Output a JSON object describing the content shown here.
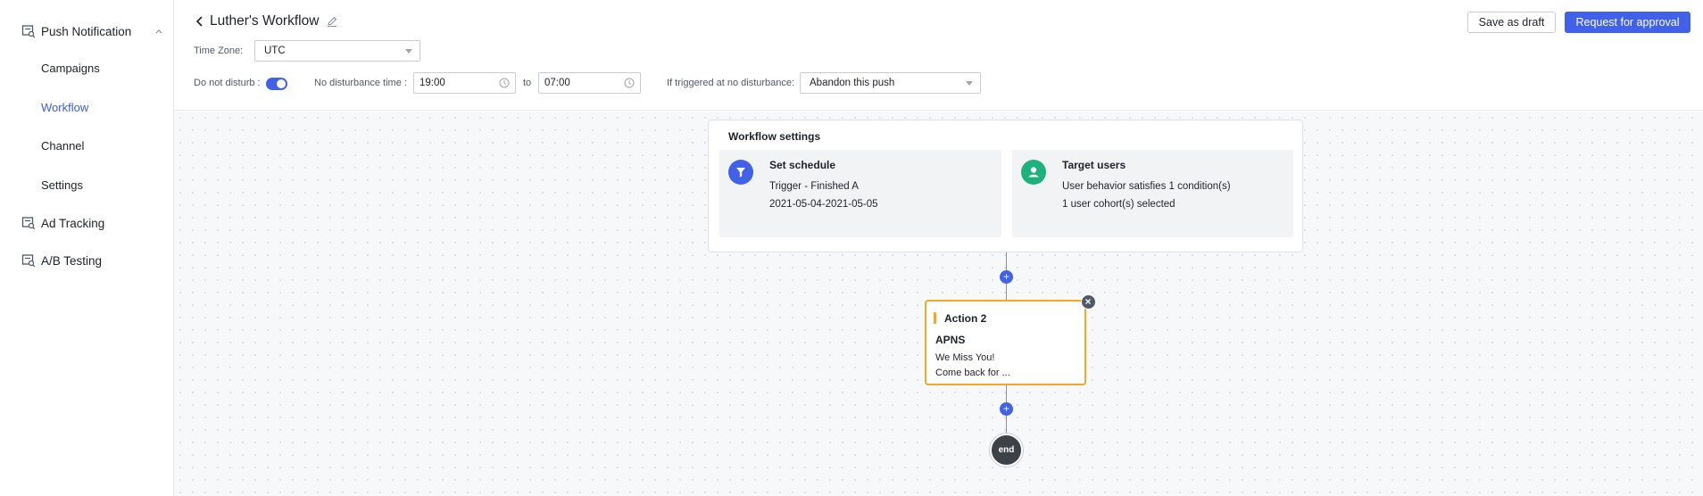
{
  "sidebar": {
    "groups": [
      {
        "label": "Push Notification",
        "icon": "push-icon",
        "expanded": true
      },
      {
        "label": "Ad Tracking",
        "icon": "ad-tracking-icon"
      },
      {
        "label": "A/B Testing",
        "icon": "ab-testing-icon"
      }
    ],
    "items": [
      {
        "label": "Campaigns",
        "active": false
      },
      {
        "label": "Workflow",
        "active": true
      },
      {
        "label": "Channel",
        "active": false
      },
      {
        "label": "Settings",
        "active": false
      }
    ]
  },
  "header": {
    "title": "Luther's Workflow",
    "save_draft_label": "Save as draft",
    "request_approval_label": "Request for approval",
    "timezone_label": "Time Zone:",
    "timezone_value": "UTC",
    "dnd_label": "Do not disturb :",
    "dnd_enabled": true,
    "no_disturb_time_label": "No disturbance time :",
    "start_time": "19:00",
    "to_label": "to",
    "end_time": "07:00",
    "triggered_label": "If triggered at no disturbance:",
    "triggered_value": "Abandon this push"
  },
  "workflow": {
    "settings_title": "Workflow settings",
    "schedule": {
      "title": "Set schedule",
      "line1": "Trigger - Finished A",
      "line2": "2021-05-04-2021-05-05"
    },
    "target": {
      "title": "Target users",
      "line1": "User behavior satisfies 1 condition(s)",
      "line2": "1 user cohort(s) selected"
    },
    "action": {
      "title": "Action 2",
      "channel": "APNS",
      "msg1": "We Miss You!",
      "msg2": "Come back for ..."
    },
    "plus_symbol": "+",
    "end_label": "end"
  },
  "colors": {
    "accent": "#4161e9",
    "action_border": "#f5a623",
    "target_icon": "#1db17b",
    "active_nav": "#3b5bdb"
  }
}
